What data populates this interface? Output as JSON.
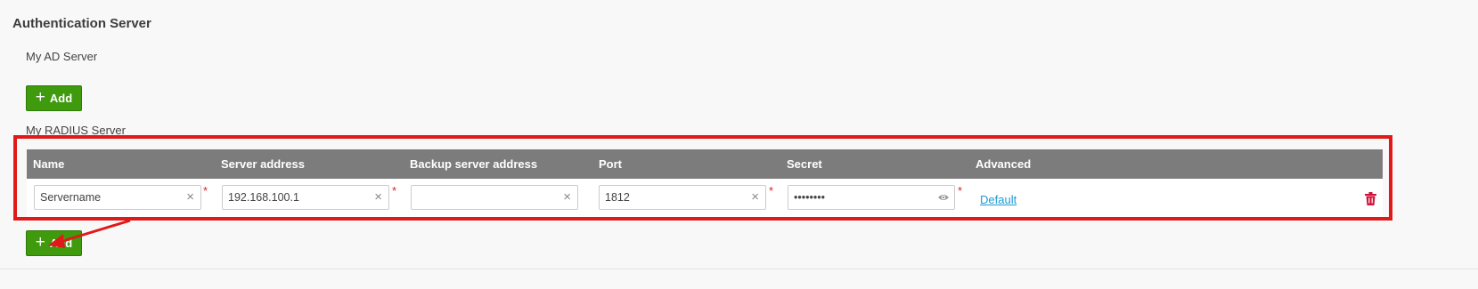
{
  "section": {
    "title": "Authentication Server"
  },
  "ad_server": {
    "label": "My AD Server",
    "add_label": "Add"
  },
  "radius_server": {
    "label": "My RADIUS Server",
    "add_label": "Add",
    "columns": [
      "Name",
      "Server address",
      "Backup server address",
      "Port",
      "Secret",
      "Advanced"
    ],
    "row": {
      "name": "Servername",
      "server_address": "192.168.100.1",
      "backup_server_address": "",
      "port": "1812",
      "secret": "••••••••",
      "advanced": "Default"
    },
    "required_mark": "*",
    "clear_glyph": "×"
  },
  "icons": {
    "add": "plus-icon",
    "clear": "clear-icon",
    "reveal": "eye-icon",
    "delete": "trash-icon"
  },
  "colors": {
    "button_green": "#3f9a0e",
    "header_gray": "#7c7c7c",
    "highlight_red": "#e01919",
    "link_blue": "#1a9bd7",
    "delete_red": "#d0143c",
    "required_red": "#e02020"
  }
}
